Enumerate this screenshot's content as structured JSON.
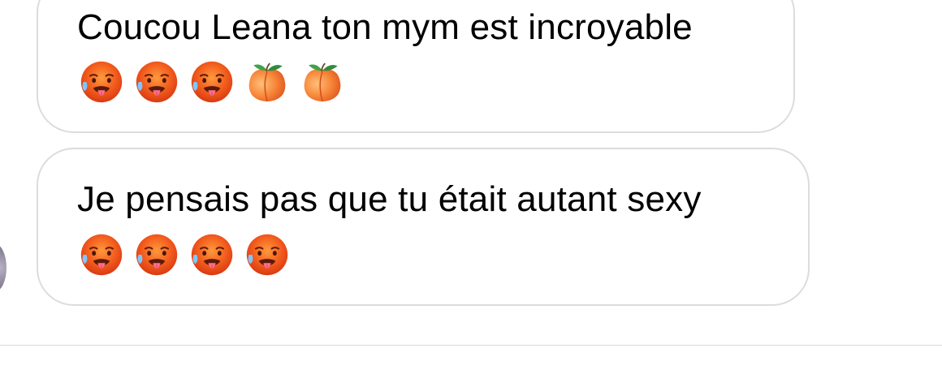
{
  "messages": [
    {
      "text": "Coucou Leana ton mym est incroyable",
      "emojis": [
        "hot-face-icon",
        "hot-face-icon",
        "hot-face-icon",
        "peach-icon",
        "peach-icon"
      ]
    },
    {
      "text": "Je pensais pas que tu était autant sexy",
      "emojis": [
        "hot-face-icon",
        "hot-face-icon",
        "hot-face-icon",
        "hot-face-icon"
      ]
    }
  ],
  "colors": {
    "bubble_border": "#dcdcdc",
    "text": "#000000",
    "background": "#ffffff"
  }
}
